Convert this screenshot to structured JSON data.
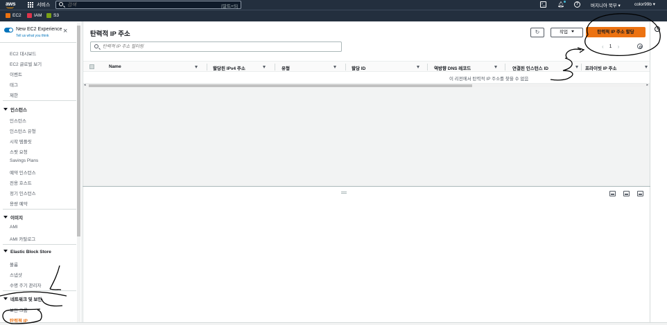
{
  "topnav": {
    "logo": "aws",
    "services": "서비스",
    "search_placeholder": "검색",
    "search_shortcut": "[알트+S]",
    "region": "버지니아 북부 ▾",
    "account": "color99b ▾"
  },
  "favorites": [
    {
      "label": "EC2",
      "color": "#ec7211"
    },
    {
      "label": "IAM",
      "color": "#dd344c"
    },
    {
      "label": "S3",
      "color": "#7aa116"
    }
  ],
  "sidebar": {
    "new_experience_title": "New EC2 Experience",
    "new_experience_sub": "Tell us what you think",
    "top_items": [
      "EC2 대시보드",
      "EC2 글로벌 보기",
      "이벤트",
      "태그",
      "제한"
    ],
    "sections": [
      {
        "title": "인스턴스",
        "items": [
          "인스턴스",
          "인스턴스 유형",
          "시작 템플릿",
          "스팟 요청",
          "Savings Plans",
          "예약 인스턴스",
          "전용 호스트",
          "정기 인스턴스",
          "용량 예약"
        ]
      },
      {
        "title": "이미지",
        "items": [
          "AMI",
          "AMI 카탈로그"
        ]
      },
      {
        "title": "Elastic Block Store",
        "items": [
          "볼륨",
          "스냅샷",
          "수명 주기 관리자"
        ]
      },
      {
        "title": "네트워크 및 보안",
        "items": [
          "보안 그룹",
          "탄력적 IP"
        ]
      }
    ],
    "active_item": "탄력적 IP"
  },
  "main": {
    "title": "탄력적 IP 주소",
    "refresh_icon": "refresh-icon",
    "actions_label": "작업",
    "allocate_label": "탄력적 IP 주소 할당",
    "filter_placeholder": "탄력적 IP 주소 필터링",
    "page_number": "1",
    "columns": [
      "Name",
      "할당된 IPv4 주소",
      "유형",
      "할당 ID",
      "역방향 DNS 레코드",
      "연결된 인스턴스 ID",
      "프라이빗 IP 주소"
    ],
    "empty_message": "이 리전에서 탄력적 IP 주소를 찾을 수 없음"
  }
}
